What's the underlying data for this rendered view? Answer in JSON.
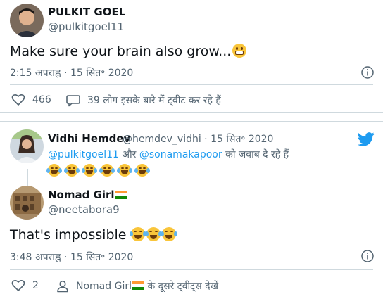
{
  "tweet1": {
    "author_name": "PULKIT GOEL",
    "author_handle": "@pulkitgoel11",
    "text": "Make sure your brain also grow...",
    "timestamp": "2:15 अपराह्न · 15 सित॰ 2020",
    "like_count": "466",
    "reply_text": "39 लोग इसके बारे में ट्वीट कर रहे हैं"
  },
  "tweet2": {
    "parent_name": "Vidhi Hemdev",
    "parent_handle_date": "@hemdev_vidhi · 15 सित॰ 2020",
    "reply_to_handle1": "@pulkitgoel11",
    "reply_to_and": "और",
    "reply_to_handle2": "@sonamakapoor",
    "reply_to_suffix": "को जवाब दे रहे हैं",
    "author_name": "Nomad Girl",
    "author_handle": "@neetabora9",
    "text": "That's impossible",
    "timestamp": "3:48 अपराह्न · 15 सित॰ 2020",
    "like_count": "2",
    "more_tweets_name": "Nomad Girl",
    "more_tweets_suffix": "के दूसरे ट्वीट्स देखें"
  },
  "icons": {
    "info": "info-icon",
    "like": "heart-icon",
    "reply": "speech-bubble-icon",
    "profile": "person-icon",
    "brand": "twitter-bird-icon",
    "emoji_grimace": "grimacing-face-emoji",
    "emoji_laugh": "tears-of-joy-emoji",
    "flag": "india-flag-emoji"
  },
  "colors": {
    "accent": "#1d9bf0",
    "text": "#0f1419",
    "muted": "#536471",
    "border": "#cfd9de"
  }
}
